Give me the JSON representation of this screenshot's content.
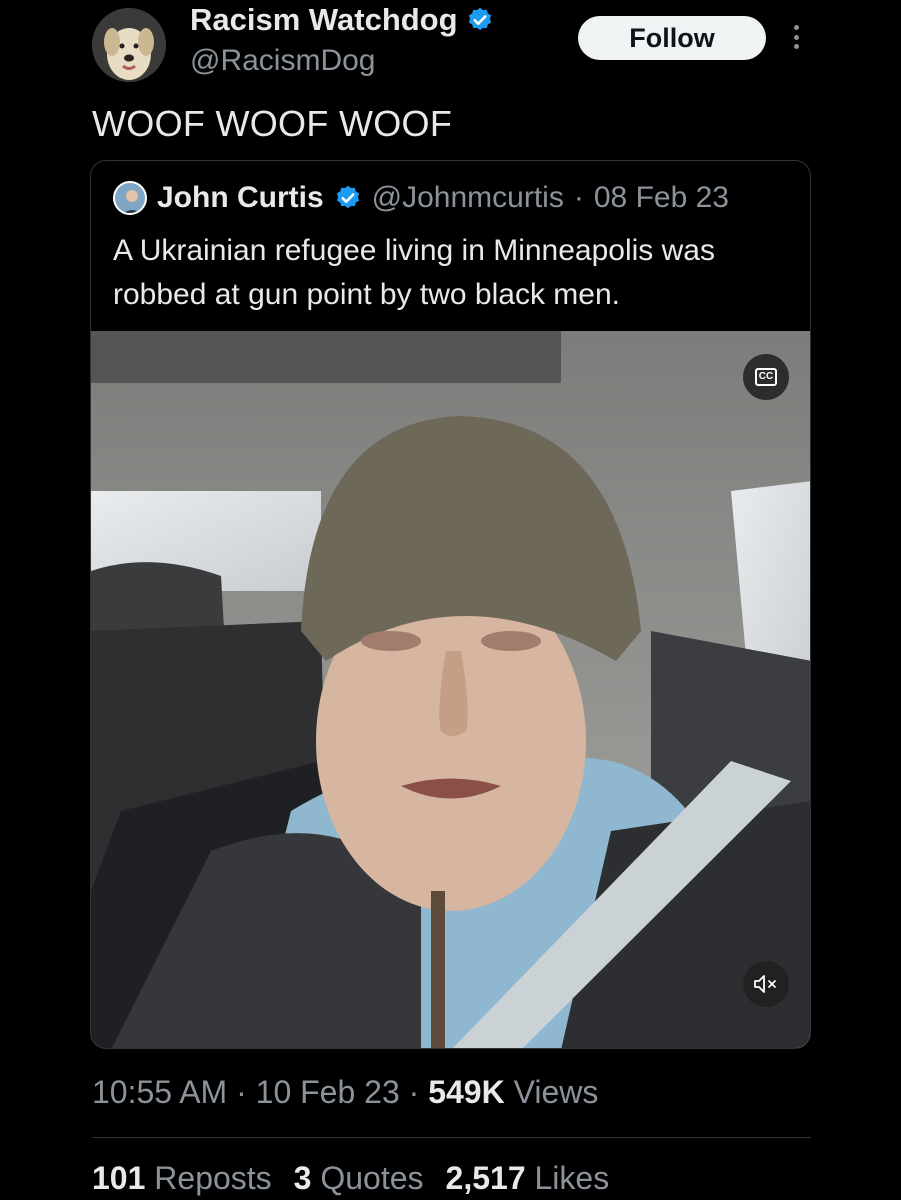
{
  "author": {
    "name": "Racism Watchdog",
    "handle": "@RacismDog",
    "verified_color": "#1d9bf0",
    "avatar_icon": "dog-avatar-icon"
  },
  "follow_label": "Follow",
  "tweet_text": "WOOF WOOF WOOF",
  "quoted": {
    "name": "John Curtis",
    "handle": "@Johnmcurtis",
    "separator": "·",
    "date": "08 Feb 23",
    "text": "A Ukrainian refugee living in Minneapolis was robbed at gun point by two black men.",
    "media": {
      "cc_label": "CC",
      "cc_icon": "closed-captions-icon",
      "mute_icon": "muted-speaker-icon"
    }
  },
  "meta": {
    "time": "10:55 AM",
    "separator": "·",
    "date": "10 Feb 23",
    "views_count": "549K",
    "views_label": "Views"
  },
  "stats": {
    "reposts_count": "101",
    "reposts_label": "Reposts",
    "quotes_count": "3",
    "quotes_label": "Quotes",
    "likes_count": "2,517",
    "likes_label": "Likes"
  },
  "colors": {
    "background": "#000000",
    "text": "#e7e9ea",
    "muted": "#8b9299",
    "divider": "#2f3336"
  }
}
